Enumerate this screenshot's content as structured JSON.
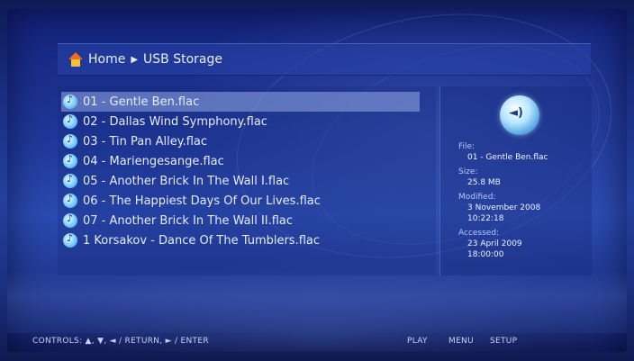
{
  "breadcrumb": {
    "home": "Home",
    "separator_icon": "right-triangle",
    "current": "USB Storage"
  },
  "files": [
    {
      "label": "01 - Gentle Ben.flac",
      "selected": true
    },
    {
      "label": "02 - Dallas Wind Symphony.flac"
    },
    {
      "label": "03 - Tin Pan Alley.flac"
    },
    {
      "label": "04 - Mariengesange.flac"
    },
    {
      "label": "05 - Another Brick In The Wall I.flac"
    },
    {
      "label": "06 - The Happiest Days Of Our Lives.flac"
    },
    {
      "label": "07 - Another Brick In The Wall II.flac"
    },
    {
      "label": "1 Korsakov - Dance Of The Tumblers.flac"
    }
  ],
  "info": {
    "file_label": "File:",
    "file_value": "01 - Gentle Ben.flac",
    "size_label": "Size:",
    "size_value": "25.8 MB",
    "modified_label": "Modified:",
    "modified_date": "3 November 2008",
    "modified_time": "10:22:18",
    "accessed_label": "Accessed:",
    "accessed_date": "23 April 2009",
    "accessed_time": "18:00:00"
  },
  "footer": {
    "controls_text": "CONTROLS:  ▲,  ▼,  ◄ / RETURN,  ► / ENTER",
    "play": "PLAY",
    "menu": "MENU",
    "setup": "SETUP"
  },
  "colors": {
    "background": "#1b2f86",
    "selection": "#96aae6",
    "text": "#e6ecff"
  }
}
